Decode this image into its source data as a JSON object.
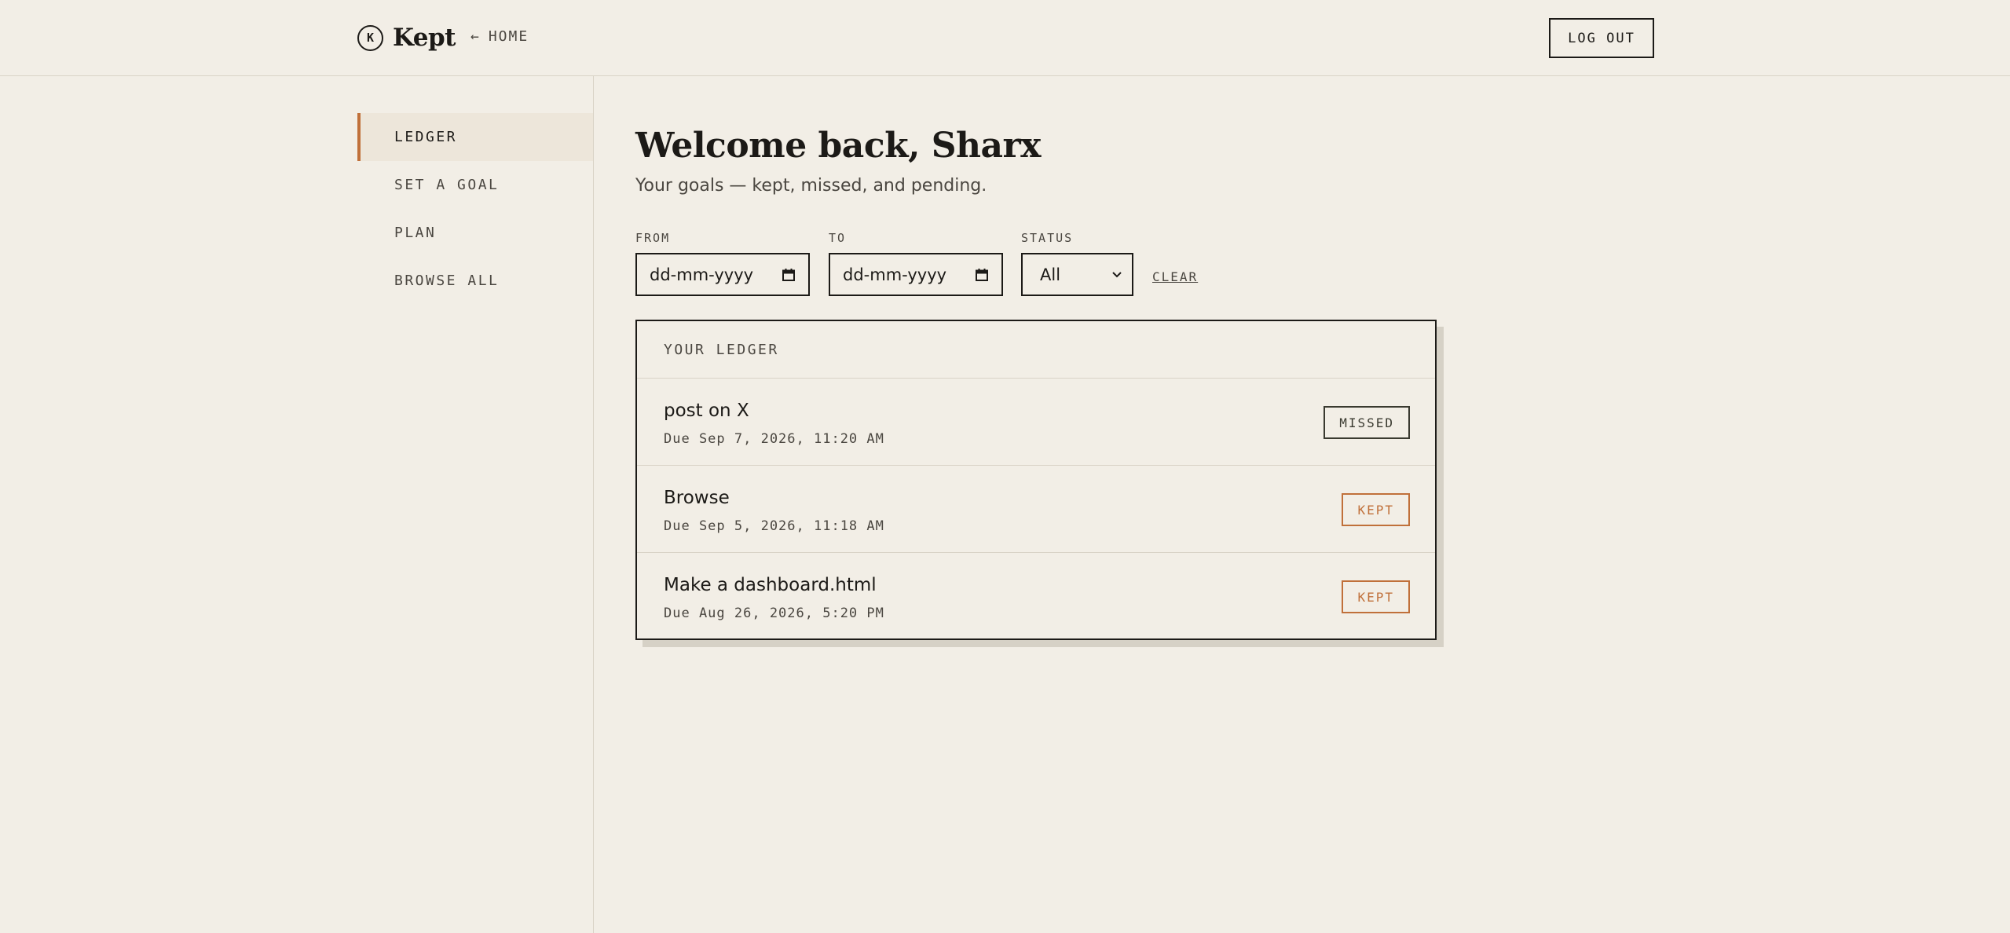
{
  "header": {
    "brand_mark": "K",
    "brand_name": "Kept",
    "home_arrow": "←",
    "home_label": "HOME",
    "logout_label": "LOG OUT"
  },
  "sidebar": {
    "items": [
      {
        "label": "LEDGER",
        "active": true
      },
      {
        "label": "SET A GOAL",
        "active": false
      },
      {
        "label": "PLAN",
        "active": false
      },
      {
        "label": "BROWSE ALL",
        "active": false
      }
    ]
  },
  "main": {
    "title": "Welcome back, Sharx",
    "subtitle": "Your goals — kept, missed, and pending.",
    "filters": {
      "from_label": "FROM",
      "from_placeholder": "dd-mm-yyyy",
      "to_label": "TO",
      "to_placeholder": "dd-mm-yyyy",
      "status_label": "STATUS",
      "status_value": "All",
      "clear_label": "CLEAR"
    },
    "ledger": {
      "header": "YOUR LEDGER",
      "rows": [
        {
          "title": "post on X",
          "due": "Due Sep 7, 2026, 11:20 AM",
          "status": "MISSED",
          "status_color": "#3a3a30"
        },
        {
          "title": "Browse",
          "due": "Due Sep 5, 2026, 11:18 AM",
          "status": "KEPT",
          "status_color": "#c0703a"
        },
        {
          "title": "Make a dashboard.html",
          "due": "Due Aug 26, 2026, 5:20 PM",
          "status": "KEPT",
          "status_color": "#c0703a"
        }
      ]
    }
  },
  "colors": {
    "background": "#f2eee6",
    "accent": "#c0703a",
    "ink": "#1c1a17",
    "muted": "#4a4640",
    "active_bg": "#ede6da"
  },
  "icons": {
    "brand": "kept-logo-icon",
    "home": "arrow-left-icon",
    "date": "calendar-icon",
    "select": "chevron-down-icon"
  }
}
